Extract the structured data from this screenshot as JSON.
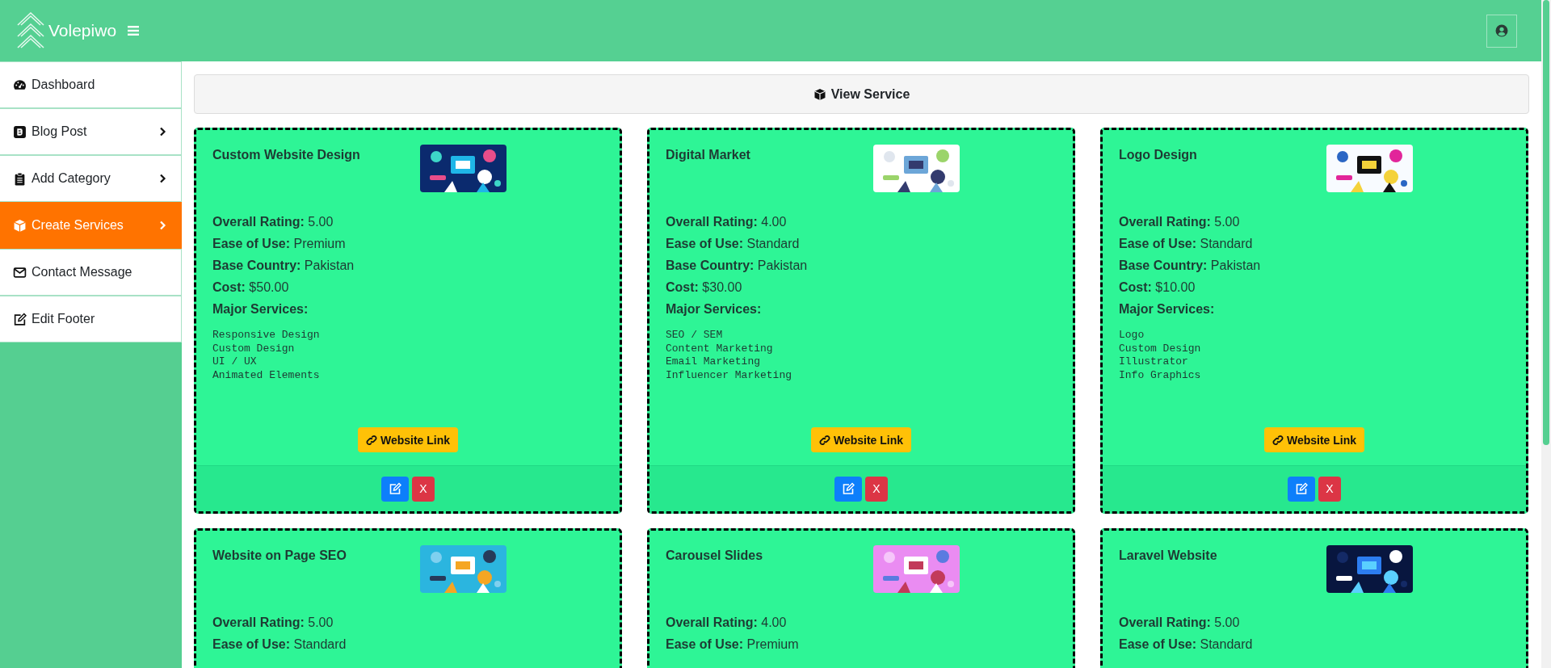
{
  "header": {
    "brand": "Volepiwo"
  },
  "sidebar": {
    "items": [
      {
        "label": "Dashboard",
        "has_submenu": false,
        "selected": false
      },
      {
        "label": "Blog Post",
        "has_submenu": true,
        "selected": false
      },
      {
        "label": "Add Category",
        "has_submenu": true,
        "selected": false
      },
      {
        "label": "Create Services",
        "has_submenu": true,
        "selected": true
      },
      {
        "label": "Contact Message",
        "has_submenu": false,
        "selected": false
      },
      {
        "label": "Edit Footer",
        "has_submenu": false,
        "selected": false
      }
    ]
  },
  "panel": {
    "title": "View Service"
  },
  "cards": [
    {
      "title": "Custom Website Design",
      "fields": [
        {
          "label": "Overall Rating:",
          "value": "5.00"
        },
        {
          "label": "Ease of Use:",
          "value": "Premium"
        },
        {
          "label": "Base Country:",
          "value": "Pakistan"
        },
        {
          "label": "Cost:",
          "value": "$50.00"
        }
      ],
      "major_label": "Major Services:",
      "services": [
        "Responsive Design",
        "Custom Design",
        "UI / UX",
        "Animated Elements"
      ],
      "link": "Website Link",
      "delete": "X"
    },
    {
      "title": "Digital Market",
      "fields": [
        {
          "label": "Overall Rating:",
          "value": "4.00"
        },
        {
          "label": "Ease of Use:",
          "value": "Standard"
        },
        {
          "label": "Base Country:",
          "value": "Pakistan"
        },
        {
          "label": "Cost:",
          "value": "$30.00"
        }
      ],
      "major_label": "Major Services:",
      "services": [
        "SEO / SEM",
        "Content Marketing",
        "Email Marketing",
        "Influencer Marketing"
      ],
      "link": "Website Link",
      "delete": "X"
    },
    {
      "title": "Logo Design",
      "fields": [
        {
          "label": "Overall Rating:",
          "value": "5.00"
        },
        {
          "label": "Ease of Use:",
          "value": "Standard"
        },
        {
          "label": "Base Country:",
          "value": "Pakistan"
        },
        {
          "label": "Cost:",
          "value": "$10.00"
        }
      ],
      "major_label": "Major Services:",
      "services": [
        "Logo",
        "Custom Design",
        "Illustrator",
        "Info Graphics"
      ],
      "link": "Website Link",
      "delete": "X"
    },
    {
      "title": "Website on Page SEO",
      "fields": [
        {
          "label": "Overall Rating:",
          "value": "5.00"
        },
        {
          "label": "Ease of Use:",
          "value": "Standard"
        }
      ]
    },
    {
      "title": "Carousel Slides",
      "fields": [
        {
          "label": "Overall Rating:",
          "value": "4.00"
        },
        {
          "label": "Ease of Use:",
          "value": "Premium"
        }
      ]
    },
    {
      "title": "Laravel Website",
      "fields": [
        {
          "label": "Overall Rating:",
          "value": "5.00"
        },
        {
          "label": "Ease of Use:",
          "value": "Standard"
        }
      ]
    }
  ]
}
